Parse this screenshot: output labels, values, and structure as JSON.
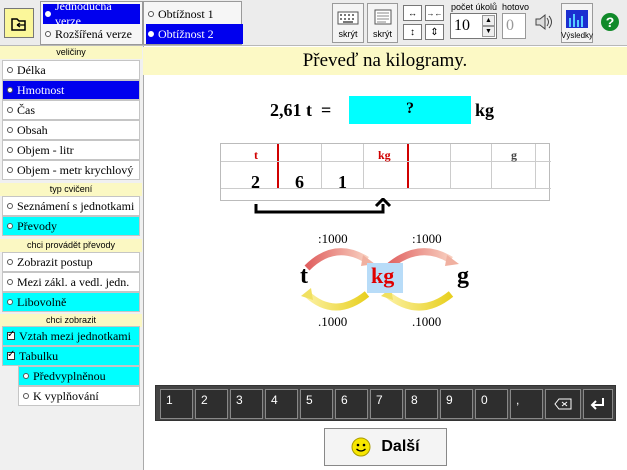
{
  "version": {
    "opt1": "Jednoduchá verze",
    "opt2": "Rozšířená verze",
    "selected": 0
  },
  "difficulty": {
    "opt1": "Obtížnost 1",
    "opt2": "Obtížnost 2",
    "selected": 1
  },
  "toolbar": {
    "keyboard_hide": "skrýt",
    "doc_hide": "skrýt",
    "count_label": "počet úkolů",
    "count_value": "10",
    "done_label": "hotovo",
    "done_value": "0",
    "results_label": "Výsledky"
  },
  "sidebar": {
    "hdr_quantities": "veličiny",
    "quantities": [
      "Délka",
      "Hmotnost",
      "Čas",
      "Obsah",
      "Objem - litr",
      "Objem - metr krychlový"
    ],
    "quantities_selected": 1,
    "hdr_exercise": "typ cvičení",
    "exercise": [
      "Seznámení s jednotkami",
      "Převody"
    ],
    "exercise_selected": 1,
    "hdr_convert": "chci provádět převody",
    "convert": [
      "Zobrazit postup",
      "Mezi zákl. a vedl. jedn.",
      "Libovolně"
    ],
    "convert_selected": 2,
    "hdr_show": "chci zobrazit",
    "show_relation": "Vztah mezi jednotkami",
    "show_table": "Tabulku",
    "table_opt1": "Předvyplněnou",
    "table_opt2": "K vyplňování"
  },
  "task": {
    "title": "Převeď na kilogramy.",
    "value": "2,61",
    "unit_from": "t",
    "equals": "=",
    "answer": "?",
    "unit_to": "kg"
  },
  "grid": {
    "headers": [
      "t",
      "kg",
      "g"
    ],
    "digits": [
      "2",
      "6",
      "1"
    ]
  },
  "diagram": {
    "left_unit": "t",
    "mid_unit": "kg",
    "right_unit": "g",
    "top_left": ":1000",
    "top_right": ":1000",
    "bot_left": ".1000",
    "bot_right": ".1000"
  },
  "keypad": [
    "1",
    "2",
    "3",
    "4",
    "5",
    "6",
    "7",
    "8",
    "9",
    "0",
    ","
  ],
  "next_label": "Další",
  "colors": {
    "accent_blue": "#0000ee",
    "cyan": "#00ffff",
    "yellow": "#fcf9c5",
    "red": "#d00000"
  }
}
